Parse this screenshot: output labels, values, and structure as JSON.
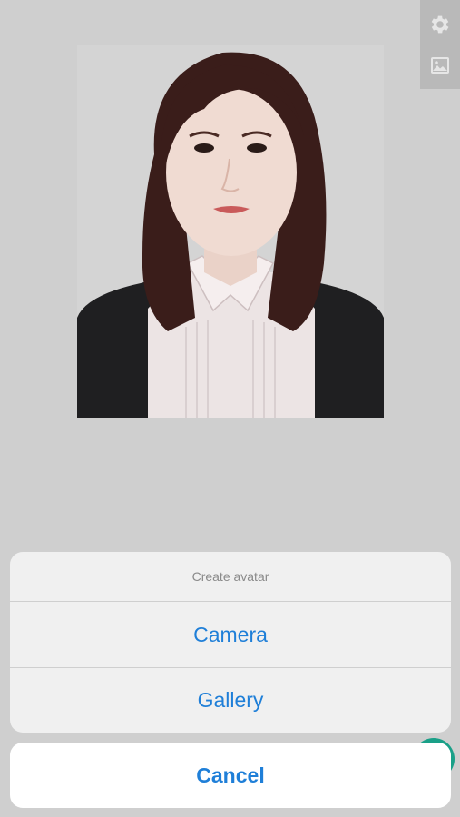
{
  "toolbar": {
    "icons": [
      "gear-icon",
      "image-icon"
    ]
  },
  "photo": {
    "subject": "portrait"
  },
  "action_sheet": {
    "title": "Create avatar",
    "options": [
      {
        "label": "Camera"
      },
      {
        "label": "Gallery"
      }
    ],
    "cancel_label": "Cancel"
  },
  "colors": {
    "background": "#cfcfcf",
    "sheet": "#f0f0f0",
    "accent": "#1f7fd8",
    "fab": "#1aa088"
  }
}
